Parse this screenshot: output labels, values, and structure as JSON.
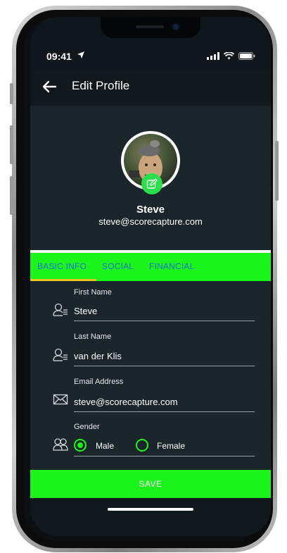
{
  "status": {
    "time": "09:41"
  },
  "appbar": {
    "title": "Edit Profile"
  },
  "profile": {
    "name": "Steve",
    "email": "steve@scorecapture.com"
  },
  "tabs": [
    {
      "label": "BASIC INFO",
      "active": true
    },
    {
      "label": "SOCIAL",
      "active": false
    },
    {
      "label": "FINANCIAL",
      "active": false
    }
  ],
  "form": {
    "first_name": {
      "label": "First Name",
      "value": "Steve"
    },
    "last_name": {
      "label": "Last Name",
      "value": "van der Klis"
    },
    "email": {
      "label": "Email Address",
      "value": "steve@scorecapture.com"
    },
    "gender": {
      "label": "Gender",
      "options": [
        "Male",
        "Female"
      ],
      "selected": "Male"
    }
  },
  "actions": {
    "save_label": "SAVE"
  },
  "colors": {
    "accent": "#1cf51c",
    "background": "#1a262c",
    "appbar": "#12191d",
    "tab_text": "#1a74c4",
    "tab_indicator": "#e6c619"
  }
}
